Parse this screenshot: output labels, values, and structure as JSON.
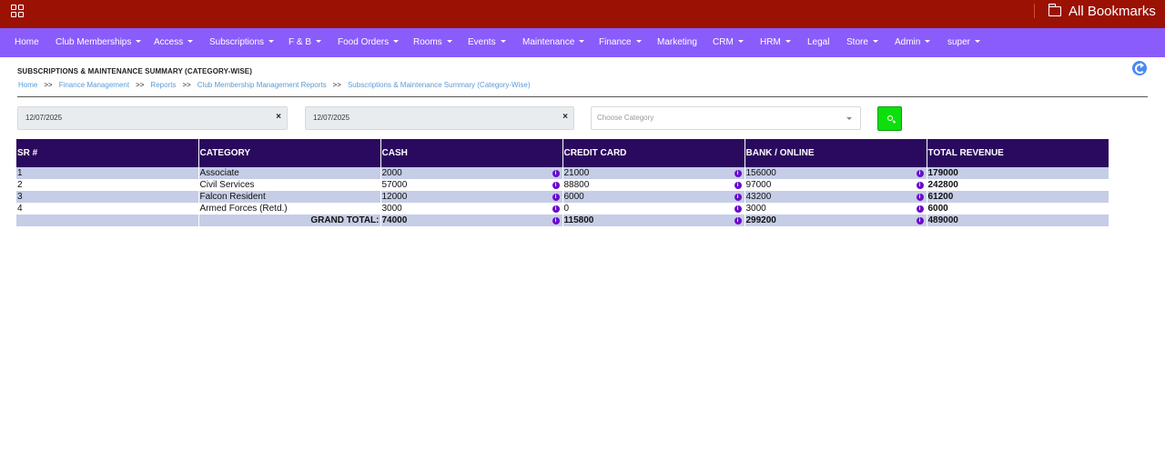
{
  "browser": {
    "bookmarks_label": "All Bookmarks"
  },
  "navbar": {
    "items": [
      {
        "label": "Home",
        "dropdown": false
      },
      {
        "label": "Club Memberships",
        "dropdown": true
      },
      {
        "label": "Access",
        "dropdown": true
      },
      {
        "label": "Subscriptions",
        "dropdown": true
      },
      {
        "label": "F & B",
        "dropdown": true
      },
      {
        "label": "Food Orders",
        "dropdown": true
      },
      {
        "label": "Rooms",
        "dropdown": true
      },
      {
        "label": "Events",
        "dropdown": true
      },
      {
        "label": "Maintenance",
        "dropdown": true
      },
      {
        "label": "Finance",
        "dropdown": true
      },
      {
        "label": "Marketing",
        "dropdown": false
      },
      {
        "label": "CRM",
        "dropdown": true
      },
      {
        "label": "HRM",
        "dropdown": true
      },
      {
        "label": "Legal",
        "dropdown": false
      },
      {
        "label": "Store",
        "dropdown": true
      },
      {
        "label": "Admin",
        "dropdown": true
      },
      {
        "label": "super",
        "dropdown": true
      }
    ]
  },
  "page": {
    "title": "SUBSCRIPTIONS & MAINTENANCE SUMMARY (CATEGORY-WISE)",
    "breadcrumb": [
      "Home",
      "Finance Management",
      "Reports",
      "Club Membership Management Reports",
      "Subscriptions & Maintenance Summary (Category-Wise)"
    ],
    "breadcrumb_sep": ">>"
  },
  "filters": {
    "date_from": "12/07/2025",
    "date_to": "12/07/2025",
    "clear_glyph": "×",
    "category_placeholder": "Choose Category"
  },
  "table": {
    "headers": [
      "SR #",
      "CATEGORY",
      "CASH",
      "CREDIT CARD",
      "BANK / ONLINE",
      "TOTAL REVENUE"
    ],
    "rows": [
      {
        "sr": "1",
        "category": "Associate",
        "cash": "2000",
        "credit_card": "21000",
        "bank_online": "156000",
        "total": "179000"
      },
      {
        "sr": "2",
        "category": "Civil Services",
        "cash": "57000",
        "credit_card": "88800",
        "bank_online": "97000",
        "total": "242800"
      },
      {
        "sr": "3",
        "category": "Falcon Resident",
        "cash": "12000",
        "credit_card": "6000",
        "bank_online": "43200",
        "total": "61200"
      },
      {
        "sr": "4",
        "category": "Armed Forces (Retd.)",
        "cash": "3000",
        "credit_card": "0",
        "bank_online": "3000",
        "total": "6000"
      }
    ],
    "grand_total": {
      "label": "GRAND TOTAL:",
      "cash": "74000",
      "credit_card": "115800",
      "bank_online": "299200",
      "total": "489000"
    },
    "info_glyph": "i"
  },
  "colors": {
    "browser_bar": "#9b1104",
    "navbar": "#8a5cfb",
    "table_header": "#2a0a5e",
    "row_stripe": "#c6cde6",
    "search_button": "#0ddf0d",
    "info_icon": "#6a0dcc"
  }
}
